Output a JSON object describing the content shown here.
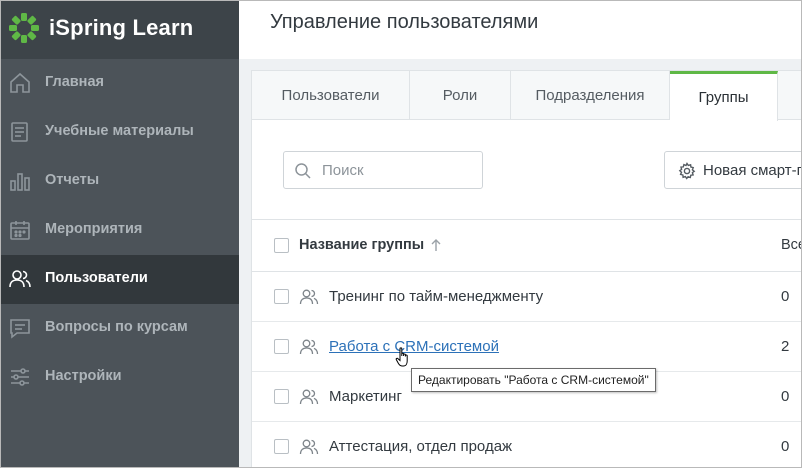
{
  "brand": {
    "name": "iSpring Learn",
    "accent": "#5fb846"
  },
  "sidebar": {
    "items": [
      {
        "label": "Главная",
        "icon": "home-icon",
        "active": false
      },
      {
        "label": "Учебные материалы",
        "icon": "book-icon",
        "active": false
      },
      {
        "label": "Отчеты",
        "icon": "bar-chart-icon",
        "active": false
      },
      {
        "label": "Мероприятия",
        "icon": "calendar-icon",
        "active": false
      },
      {
        "label": "Пользователи",
        "icon": "users-icon",
        "active": true
      },
      {
        "label": "Вопросы по курсам",
        "icon": "chat-icon",
        "active": false
      },
      {
        "label": "Настройки",
        "icon": "sliders-icon",
        "active": false
      }
    ]
  },
  "header": {
    "title": "Управление пользователями"
  },
  "tabs": [
    {
      "label": "Пользователи",
      "active": false
    },
    {
      "label": "Роли",
      "active": false
    },
    {
      "label": "Подразделения",
      "active": false
    },
    {
      "label": "Группы",
      "active": true
    }
  ],
  "toolbar": {
    "search_placeholder": "Поиск",
    "smart_group_label": "Новая смарт-г"
  },
  "table": {
    "columns": {
      "name": "Название группы",
      "count": "Все"
    },
    "rows": [
      {
        "name": "Тренинг по тайм-менеджменту",
        "count": "0",
        "link": false
      },
      {
        "name": "Работа с CRM-системой",
        "count": "2",
        "link": true
      },
      {
        "name": "Маркетинг",
        "count": "0",
        "link": false
      },
      {
        "name": "Аттестация, отдел продаж",
        "count": "0",
        "link": false
      }
    ]
  },
  "tooltip": {
    "text": "Редактировать \"Работа с CRM-системой\""
  }
}
